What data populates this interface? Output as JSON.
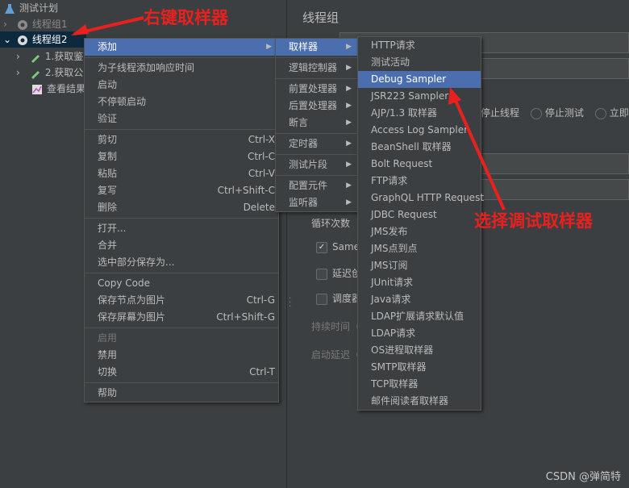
{
  "tree": {
    "root": "测试计划",
    "group1": "线程组1",
    "group2": "线程组2",
    "child1": "1.获取鉴",
    "child2": "2.获取公",
    "child3": "查看结果"
  },
  "panel": {
    "title": "线程组",
    "stop_thread": "停止线程",
    "stop_test": "停止测试",
    "stop_now": "立即",
    "loop_count": "循环次数",
    "same_user": "Same",
    "delay_create": "延迟创",
    "scheduler": "调度器",
    "duration": "持续时间（",
    "startup_delay": "启动延迟（"
  },
  "context_menu": {
    "add": "添加",
    "add_think_time": "为子线程添加响应时间",
    "start": "启动",
    "start_no_pause": "不停顿启动",
    "validate": "验证",
    "cut": "剪切",
    "cut_sc": "Ctrl-X",
    "copy": "复制",
    "copy_sc": "Ctrl-C",
    "paste": "粘贴",
    "paste_sc": "Ctrl-V",
    "duplicate": "复写",
    "duplicate_sc": "Ctrl+Shift-C",
    "delete": "删除",
    "delete_sc": "Delete",
    "open": "打开...",
    "merge": "合并",
    "save_selection": "选中部分保存为...",
    "copy_code": "Copy Code",
    "save_node_img": "保存节点为图片",
    "save_node_img_sc": "Ctrl-G",
    "save_screen_img": "保存屏幕为图片",
    "save_screen_img_sc": "Ctrl+Shift-G",
    "enable": "启用",
    "disable": "禁用",
    "toggle": "切换",
    "toggle_sc": "Ctrl-T",
    "help": "帮助"
  },
  "add_menu": {
    "sampler": "取样器",
    "logic_controller": "逻辑控制器",
    "pre_processor": "前置处理器",
    "post_processor": "后置处理器",
    "assertion": "断言",
    "timer": "定时器",
    "test_fragment": "测试片段",
    "config_element": "配置元件",
    "listener": "监听器"
  },
  "sampler_menu": [
    "HTTP请求",
    "测试活动",
    "Debug Sampler",
    "JSR223 Sampler",
    "AJP/1.3 取样器",
    "Access Log Sampler",
    "BeanShell 取样器",
    "Bolt Request",
    "FTP请求",
    "GraphQL HTTP Request",
    "JDBC Request",
    "JMS发布",
    "JMS点到点",
    "JMS订阅",
    "JUnit请求",
    "Java请求",
    "LDAP扩展请求默认值",
    "LDAP请求",
    "OS进程取样器",
    "SMTP取样器",
    "TCP取样器",
    "邮件阅读者取样器"
  ],
  "annotations": {
    "right_click": "右键取样器",
    "choose_debug": "选择调试取样器"
  },
  "watermark": "CSDN @弹简特",
  "colors": {
    "highlight": "#4b6eaf",
    "annotation": "#e8211f",
    "background": "#3c3f41"
  }
}
